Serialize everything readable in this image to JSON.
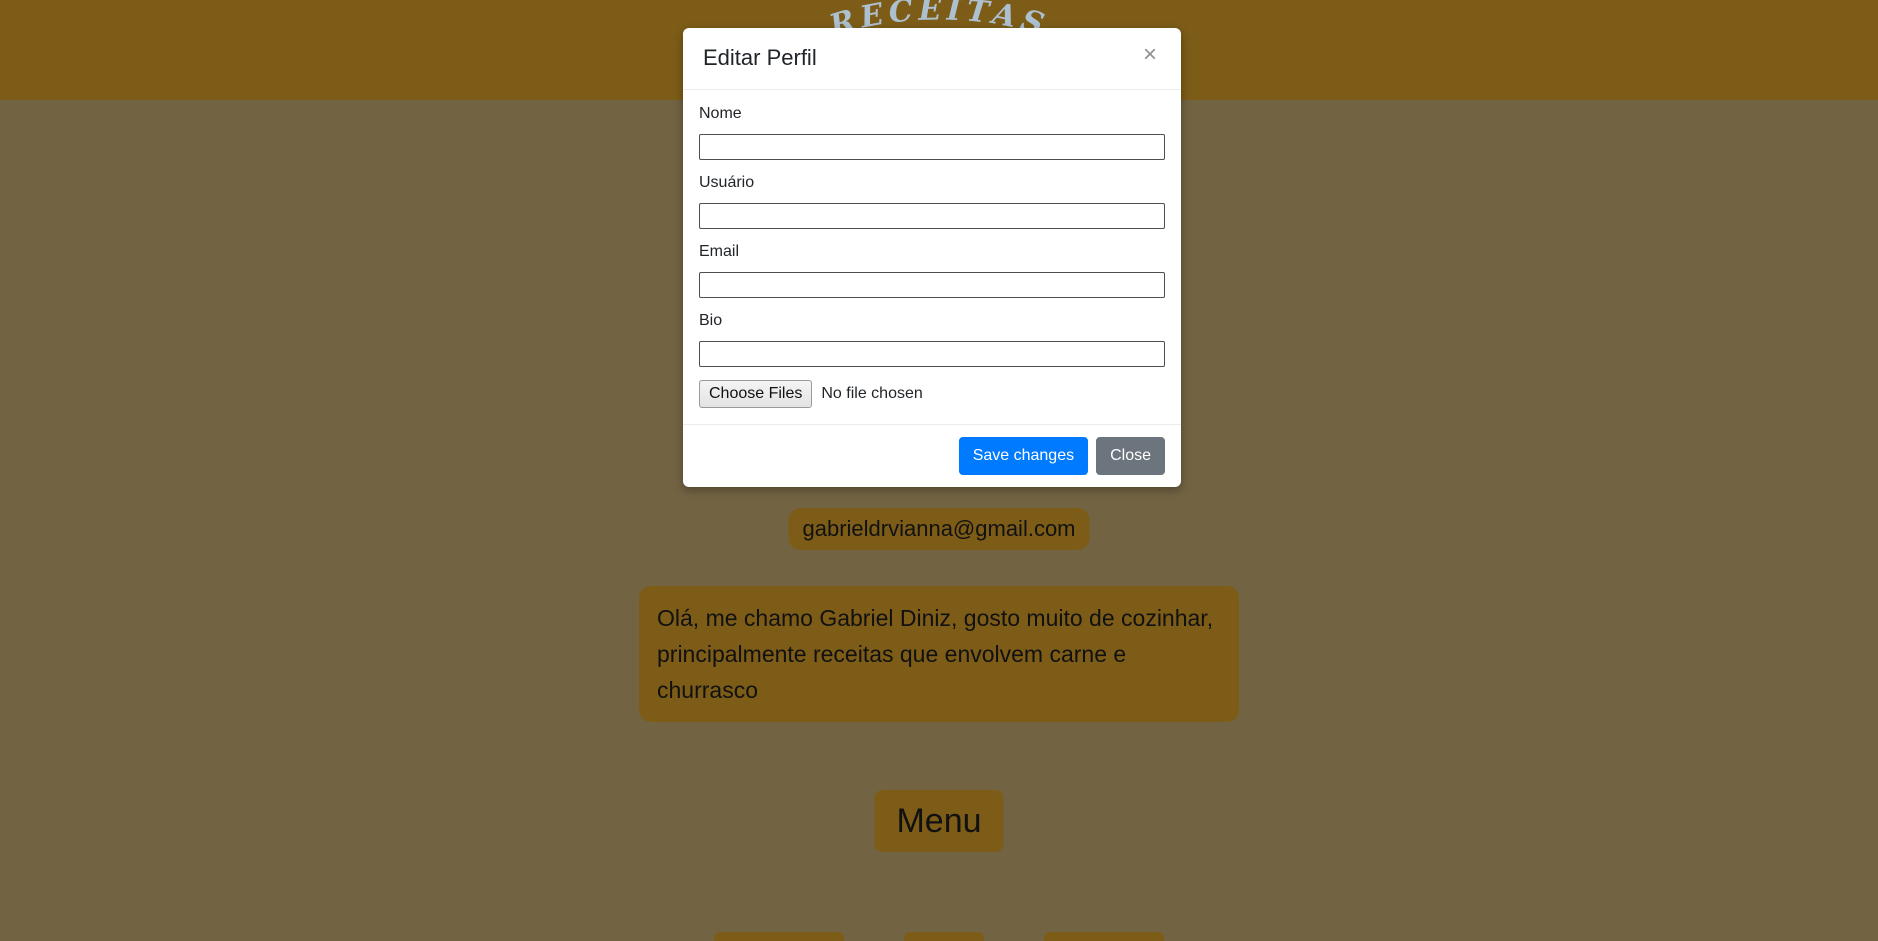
{
  "theme": {
    "header_bg": "#7d5c17",
    "page_bg": "#726343",
    "accent_brown": "#7d5c17",
    "primary_blue": "#007bff",
    "secondary_gray": "#6c757d",
    "modal_bg": "#ffffff"
  },
  "header": {
    "brand_text": "RECEITAS",
    "brand_color": "#adc0cf"
  },
  "profile": {
    "email": "gabrieldrvianna@gmail.com",
    "bio": "Olá, me chamo Gabriel Diniz, gosto muito de cozinhar, principalmente receitas que envolvem carne e churrasco",
    "menu_label": "Menu"
  },
  "modal": {
    "title": "Editar Perfil",
    "close_icon": "×",
    "fields": [
      {
        "label": "Nome",
        "value": "",
        "placeholder": "",
        "name": "nome"
      },
      {
        "label": "Usuário",
        "value": "",
        "placeholder": "",
        "name": "usuario"
      },
      {
        "label": "Email",
        "value": "",
        "placeholder": "",
        "name": "email"
      },
      {
        "label": "Bio",
        "value": "",
        "placeholder": "",
        "name": "bio"
      }
    ],
    "file_input": {
      "button_label": "Choose Files",
      "status_text": "No file chosen"
    },
    "footer": {
      "save_label": "Save changes",
      "close_label": "Close"
    }
  },
  "bottom_nav": {
    "items": [
      "",
      "",
      ""
    ]
  }
}
